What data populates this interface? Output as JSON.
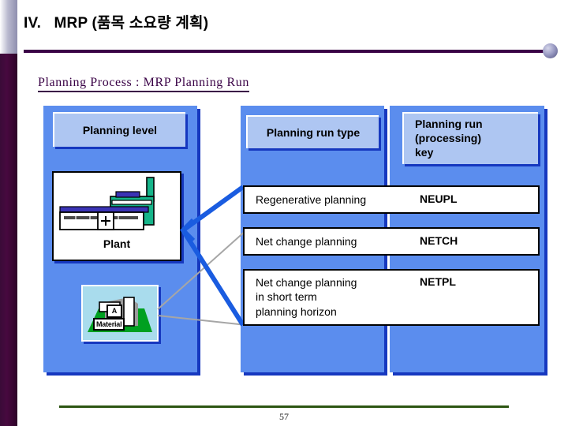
{
  "header": {
    "title": "IV.   MRP (품목 소요량 계획)",
    "bullet_icon": "sphere-bullet-icon",
    "rule_color": "#3a0246"
  },
  "subtitle": {
    "text": "Planning Process : MRP Planning Run",
    "color": "#3a0246"
  },
  "columns": {
    "planning_level": "Planning level",
    "planning_run_type": "Planning run type",
    "planning_run_key_line1": "Planning run",
    "planning_run_key_line2": "(processing)",
    "planning_run_key_line3": "key"
  },
  "level_items": {
    "plant": {
      "caption": "Plant",
      "icon": "factory-plant-icon"
    },
    "material": {
      "caption": "Material",
      "block_label": "A",
      "icon": "material-stack-icon"
    }
  },
  "table": {
    "rows": [
      {
        "type": "Regenerative planning",
        "key": "NEUPL"
      },
      {
        "type": "Net change planning",
        "key": "NETCH"
      },
      {
        "type": "Net change planning\nin short term\nplanning horizon",
        "key": "NETPL"
      }
    ]
  },
  "connectors": {
    "plant_line_color": "#1a5ce0",
    "material_line_color": "#a6a6a6"
  },
  "footer": {
    "page_number": "57",
    "rule_color": "#2c5511"
  },
  "theme": {
    "panel_blue": "#5b8dee",
    "panel_shadow_blue": "#1638bf",
    "header_box_blue": "#aec6f2",
    "material_bg": "#a9dced",
    "material_ground_green": "#00a020"
  }
}
